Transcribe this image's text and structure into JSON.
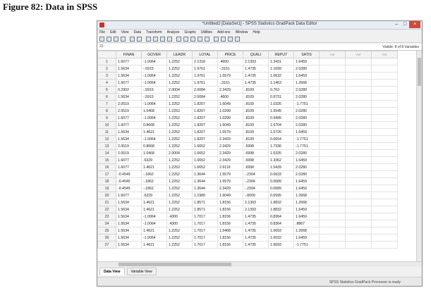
{
  "figure_title": "Figure 82: Data in SPSS",
  "window": {
    "title": "*Untitled2 [DataSet1] - SPSS Statistics GradPack Data Editor",
    "controls": [
      "–",
      "□",
      "×"
    ]
  },
  "menu": [
    "File",
    "Edit",
    "View",
    "Data",
    "Transform",
    "Analyze",
    "Graphs",
    "Utilities",
    "Add-ons",
    "Window",
    "Help"
  ],
  "toolbar_icons": [
    "open-icon",
    "save-icon",
    "print-icon",
    "recall-dialog-icon",
    "undo-icon",
    "redo-icon",
    "goto-case-icon",
    "goto-variable-icon",
    "variables-icon",
    "find-icon",
    "insert-cases-icon",
    "insert-variable-icon",
    "split-file-icon",
    "weight-cases-icon",
    "select-cases-icon",
    "value-labels-icon",
    "use-sets-icon",
    "show-all-icon",
    "spell-icon"
  ],
  "cell_editor": {
    "ref": "22 :",
    "visible": "Visible: 8 of 8 Variables"
  },
  "columns": [
    "FINAN",
    "GOVER",
    "LEADR",
    "LOYAL",
    "PRICE",
    "QUALI",
    "REPUT",
    "SATIS",
    "var",
    "var",
    "var"
  ],
  "rows": [
    [
      "1.6077",
      "-1.0064",
      "1.2252",
      "2.1318",
      ".4600",
      "2.1393",
      "1.3431",
      "1.6459"
    ],
    [
      "1.5634",
      "-.5915",
      "1.2252",
      "1.9761",
      "-.3161",
      "1.4735",
      "1.1699",
      "2.0280"
    ],
    [
      "1.5634",
      "-1.0064",
      "1.2252",
      "1.9761",
      "1.5579",
      "1.4735",
      "1.0632",
      "1.6459"
    ],
    [
      "1.6077",
      "-1.0064",
      "1.2252",
      "1.9761",
      "-.3161",
      "1.4735",
      "1.1463",
      "1.2668"
    ],
    [
      "0.2902",
      "-.5915",
      "2.0004",
      "2.0084",
      "2.3429",
      ".8109",
      "0.763",
      "2.0280"
    ],
    [
      "1.5634",
      "-.5915",
      "1.2252",
      "2.0084",
      ".4600",
      ".8109",
      "0.9731",
      "2.0280"
    ],
    [
      "2.0519",
      "-1.0064",
      "1.2252",
      "1.8207",
      "1.6049",
      ".8109",
      "1.0326",
      "-1.7751"
    ],
    [
      "2.0519",
      "1.0468",
      "1.2252",
      "1.8207",
      "1.0299",
      ".8109",
      "1.5545",
      "2.0280"
    ],
    [
      "1.6077",
      "-1.0064",
      "1.2252",
      "1.8207",
      "1.0299",
      ".8109",
      "0.9495",
      "2.0280"
    ],
    [
      "1.6077",
      "0.8668",
      "1.2252",
      "1.8207",
      "1.6049",
      ".8109",
      "1.6704",
      "2.0280"
    ],
    [
      "1.5634",
      "1.4621",
      "1.2252",
      "1.8207",
      "1.5579",
      ".8109",
      "1.5726",
      "1.6459"
    ],
    [
      "1.5634",
      "-1.0064",
      "1.2252",
      "1.8207",
      "2.3429",
      ".8109",
      "0.0654",
      "-1.7751"
    ],
    [
      "2.0519",
      "0.8668",
      "1.2252",
      "1.6652",
      "2.3429",
      ".6998",
      "1.7336",
      "-1.7751"
    ],
    [
      "2.0519",
      "1.0468",
      "2.0004",
      "1.6652",
      "2.3429",
      ".6998",
      "1.5335",
      "2.0280"
    ],
    [
      "1.6077",
      ".6329",
      "1.2252",
      "1.6652",
      "2.3429",
      ".6998",
      "1.3362",
      "1.6459"
    ],
    [
      "1.6077",
      "1.4621",
      "1.2252",
      "1.6652",
      "2.6119",
      ".6998",
      "1.5439",
      "2.0280"
    ],
    [
      "-0.4545",
      "-.1862",
      "1.2252",
      "1.3644",
      "1.5579",
      "-.2304",
      "0.0633",
      "2.0280"
    ],
    [
      "-0.4545",
      "-.1862",
      "1.2252",
      "1.3644",
      "1.5579",
      "-.2304",
      "0.0689",
      "1.6459"
    ],
    [
      "-0.4545",
      "-.1862",
      "1.2252",
      "1.3644",
      "2.3429",
      "-.2304",
      "0.0689",
      "1.6459"
    ],
    [
      "1.6077",
      ".6329",
      "1.2252",
      "1.1989",
      "1.6049",
      "-.8009",
      "0.6595",
      "1.2668"
    ],
    [
      "1.5634",
      "1.4621",
      "1.2252",
      "1.8571",
      "1.8156",
      "2.1393",
      "1.8832",
      "1.2668"
    ],
    [
      "1.5634",
      "1.4621",
      "1.2252",
      "1.8571",
      "1.8156",
      "2.1393",
      "1.8832",
      "1.6459"
    ],
    [
      "1.5634",
      "-1.0064",
      ".4300",
      "1.7017",
      "1.8156",
      "1.4735",
      "0.8364",
      "1.6459"
    ],
    [
      "1.5634",
      "-1.0064",
      ".4300",
      "1.7017",
      "1.8156",
      "1.4735",
      "0.8364",
      ".8867"
    ],
    [
      "1.5634",
      "1.4621",
      "1.2252",
      "1.7017",
      "1.5468",
      "1.4735",
      "1.0693",
      "1.2668"
    ],
    [
      "1.5634",
      "-1.0064",
      "1.2252",
      "1.7017",
      "1.8156",
      "1.4735",
      "1.0032",
      "1.6459"
    ],
    [
      "1.5634",
      "1.4621",
      "1.2252",
      "1.7017",
      "1.8156",
      "1.4735",
      "1.6693",
      "-1.7751"
    ]
  ],
  "tabs": [
    "Data View",
    "Variable View"
  ],
  "status": "SPSS Statistics GradPack Processor is ready"
}
